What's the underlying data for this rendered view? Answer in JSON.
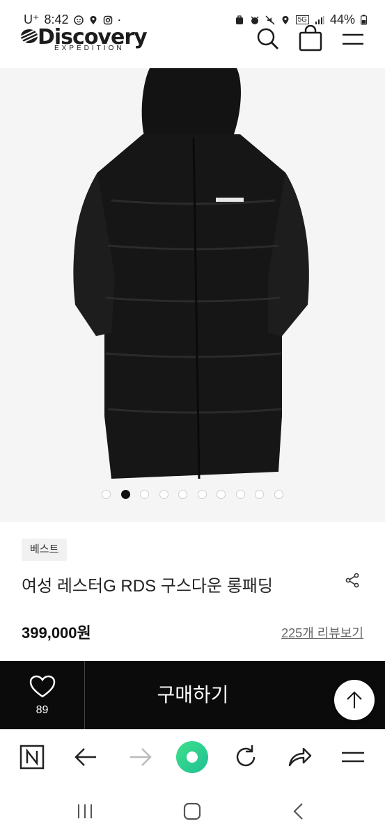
{
  "status_bar": {
    "carrier": "U⁺",
    "time": "8:42",
    "network": "5G",
    "battery": "44%"
  },
  "header": {
    "logo_main": "Discovery",
    "logo_sub": "EXPEDITION"
  },
  "gallery": {
    "image_count": 10,
    "active_index": 1
  },
  "product": {
    "badge": "베스트",
    "title": "여성 레스터G RDS 구스다운 롱패딩",
    "price": "399,000원",
    "reviews_link": "225개 리뷰보기"
  },
  "buy_bar": {
    "like_count": "89",
    "buy_label": "구매하기"
  },
  "colors": {
    "buy_bar_bg": "#0b0b0b",
    "browser_home_accent": "#35d07f"
  }
}
